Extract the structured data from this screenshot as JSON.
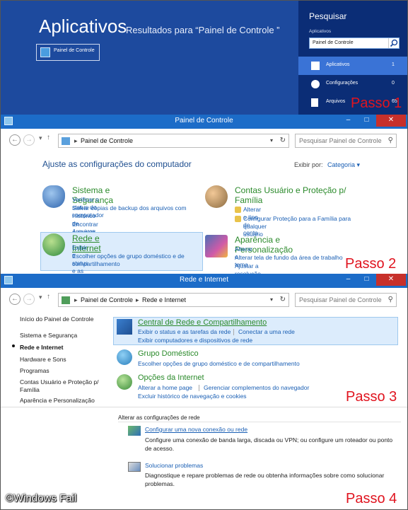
{
  "section1": {
    "title": "Aplicativos",
    "subtitle": "Resultados para “Painel de Controle ”",
    "result_tile": "Painel de Controle",
    "search_pane": {
      "title": "Pesquisar",
      "scope_label": "Aplicativos",
      "query": "Painel de Controle",
      "rows": [
        {
          "label": "Aplicativos",
          "count": "1"
        },
        {
          "label": "Configurações",
          "count": "0"
        },
        {
          "label": "Arquivos",
          "count": "65"
        }
      ]
    },
    "passo": "Passo 1"
  },
  "window2": {
    "title": "Painel de Controle",
    "address": [
      "Painel de Controle"
    ],
    "search_placeholder": "Pesquisar Painel de Controle",
    "heading": "Ajuste as configurações do computador",
    "view_by_label": "Exibir por:",
    "view_by_value": "Categoria",
    "categories": [
      {
        "title": "Sistema e Segurança",
        "links": [
          "Verificar o status do computador",
          "Salvar cópias de backup dos arquivos com",
          "Histórico de Arquivos",
          "Encontrar e corrigir problemas"
        ]
      },
      {
        "title": "Contas Usuário e Proteção p/",
        "title2": "Família",
        "links": [
          "Alterar o tipo de conta",
          "Configurar Proteção para a Família para",
          "qualquer usuário"
        ]
      },
      {
        "title": "Rede e Internet",
        "links": [
          "Exibir o status e as tarefas da rede",
          "Escolher opções de grupo doméstico e de",
          "compartilhamento"
        ]
      },
      {
        "title": "Aparência e Personalização",
        "links": [
          "Alterar o tema",
          "Alterar tela de fundo da área de trabalho",
          "Ajustar a resolução da tela"
        ]
      }
    ],
    "passo": "Passo 2"
  },
  "window3": {
    "title": "Rede e Internet",
    "address": [
      "Painel de Controle",
      "Rede e Internet"
    ],
    "search_placeholder": "Pesquisar Painel de Controle",
    "sidebar": [
      "Início do Painel de Controle",
      "Sistema e Segurança",
      "Rede e Internet",
      "Hardware e Sons",
      "Programas",
      "Contas Usuário e Proteção p/",
      "Família",
      "Aparência e Personalização"
    ],
    "sections": [
      {
        "title": "Central de Rede e Compartilhamento",
        "links": [
          "Exibir o status e as tarefas da rede",
          "Conectar a uma rede",
          "Exibir computadores e dispositivos de rede"
        ]
      },
      {
        "title": "Grupo Doméstico",
        "links": [
          "Escolher opções de grupo doméstico e de compartilhamento"
        ]
      },
      {
        "title": "Opções da Internet",
        "links": [
          "Alterar a home page",
          "Gerenciar complementos do navegador",
          "Excluir histórico de navegação e cookies"
        ]
      }
    ],
    "passo": "Passo 3"
  },
  "section4": {
    "heading": "Alterar as configurações de rede",
    "items": [
      {
        "link": "Configurar uma nova conexão ou rede",
        "desc1": "Configure uma conexão de banda larga, discada ou VPN; ou configure um roteador ou ponto",
        "desc2": "de acesso."
      },
      {
        "link": "Solucionar problemas",
        "desc1": "Diagnostique e repare problemas de rede ou obtenha informações sobre como solucionar",
        "desc2": "problemas."
      }
    ],
    "watermark": "©Windows Fail",
    "passo": "Passo 4"
  }
}
